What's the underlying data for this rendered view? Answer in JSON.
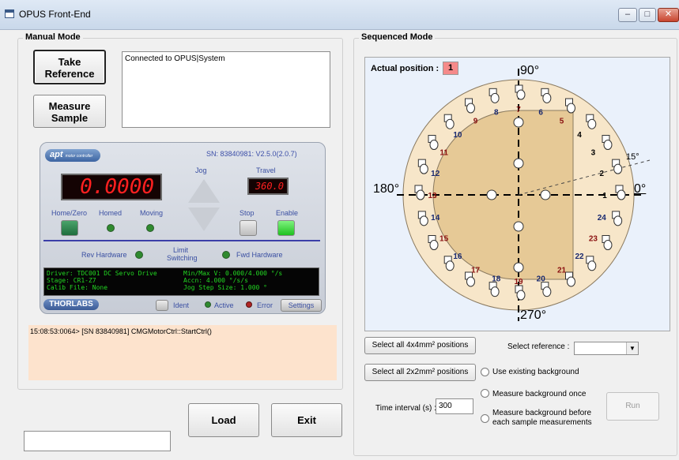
{
  "window": {
    "title": "OPUS Front-End",
    "min": "–",
    "max": "□",
    "close": "✕"
  },
  "manual": {
    "legend": "Manual Mode",
    "take_reference_l1": "Take",
    "take_reference_l2": "Reference",
    "measure_sample_l1": "Measure",
    "measure_sample_l2": "Sample",
    "status": "Connected to OPUS|System",
    "apt": {
      "logo": "apt",
      "logo_sub": "motor controller",
      "sn": "SN: 83840981: V2.5.0(2.0.7)",
      "jog": "Jog",
      "travel": "Travel",
      "position": "0.0000",
      "travel_value": "360.0",
      "home_zero": "Home/Zero",
      "homed": "Homed",
      "moving": "Moving",
      "stop": "Stop",
      "enable": "Enable",
      "rev_hardware": "Rev Hardware",
      "limit_switching_l1": "Limit",
      "limit_switching_l2": "Switching",
      "fwd_hardware": "Fwd Hardware",
      "info_left": [
        "Driver: TDC001 DC Servo Drive",
        "Stage: CR1-Z7",
        "Calib File: None"
      ],
      "info_right": [
        "Min/Max V: 0.000/4.000 °/s",
        "Accn: 4.000 °/s/s",
        "Jog Step Size: 1.000 °"
      ],
      "thorlabs": "THORLABS",
      "ident": "Ident",
      "active": "Active",
      "error": "Error",
      "settings": "Settings",
      "colors": {
        "led_green": "#3cc93c",
        "led_red": "#c0282a",
        "lcd_red": "#ff2020"
      }
    },
    "log": "15:08:53:0064> [SN 83840981] CMGMotorCtrl::StartCtrl()"
  },
  "bottom": {
    "load": "Load",
    "exit": "Exit",
    "input_value": ""
  },
  "sequenced": {
    "legend": "Sequenced Mode",
    "actual_position_label": "Actual position :",
    "actual_position_value": "1",
    "angles": {
      "top": "90°",
      "left": "180°",
      "right": "0°",
      "bottom": "270°",
      "small": "15°"
    },
    "positions": [
      "1",
      "2",
      "3",
      "4",
      "5",
      "6",
      "7",
      "8",
      "9",
      "10",
      "11",
      "12",
      "13",
      "14",
      "15",
      "16",
      "17",
      "18",
      "19",
      "20",
      "21",
      "22",
      "23",
      "24"
    ],
    "select_4x4": "Select all 4x4mm² positions",
    "select_2x2": "Select all 2x2mm² positions",
    "select_reference_label": "Select reference :",
    "select_reference_value": "",
    "use_existing": "Use existing background",
    "measure_once": "Measure background once",
    "measure_before_l1": "Measure background before",
    "measure_before_l2": "each sample measurements",
    "time_interval_label": "Time interval (s) :",
    "time_interval_value": "300",
    "run": "Run"
  }
}
